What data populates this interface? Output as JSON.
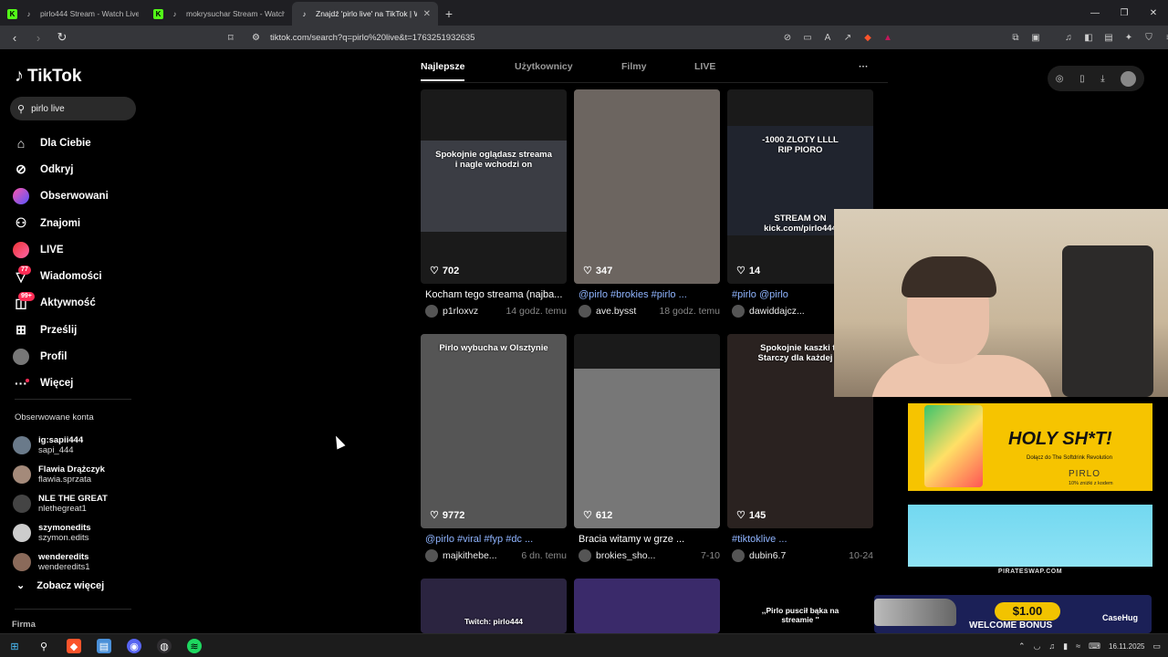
{
  "browser": {
    "tabs": [
      {
        "title": "pirlo444 Stream - Watch Live on",
        "fav_color": "#53fc18",
        "active": false
      },
      {
        "title": "mokrysuchar Stream - Watch Live",
        "fav_color": "#53fc18",
        "active": false
      },
      {
        "title": "Znajdź 'pirlo live' na TikTok | Wy",
        "fav_color": "#000000",
        "active": true
      }
    ],
    "new_tab": "+",
    "url": "tiktok.com/search?q=pirlo%20live&t=1763251932635"
  },
  "sidebar": {
    "logo": "TikTok",
    "search_value": "pirlo live",
    "nav": [
      {
        "label": "Dla Ciebie",
        "icon": "home-icon",
        "glyph": "⌂"
      },
      {
        "label": "Odkryj",
        "icon": "compass-icon",
        "glyph": "⊘"
      },
      {
        "label": "Obserwowani",
        "icon": "following-avatar-icon",
        "glyph": ""
      },
      {
        "label": "Znajomi",
        "icon": "friends-icon",
        "glyph": "⚇"
      },
      {
        "label": "LIVE",
        "icon": "live-avatar-icon",
        "glyph": ""
      },
      {
        "label": "Wiadomości",
        "icon": "messages-icon",
        "glyph": "▽",
        "badge": "77"
      },
      {
        "label": "Aktywność",
        "icon": "activity-icon",
        "glyph": "◫",
        "badge": "99+"
      },
      {
        "label": "Prześlij",
        "icon": "upload-icon",
        "glyph": "⊞"
      },
      {
        "label": "Profil",
        "icon": "profile-avatar-icon",
        "glyph": ""
      },
      {
        "label": "Więcej",
        "icon": "more-icon",
        "glyph": "···"
      }
    ],
    "following_header": "Obserwowane konta",
    "following": [
      {
        "name": "ig:sapii444",
        "handle": "sapi_444"
      },
      {
        "name": "Flawia Drążczyk",
        "handle": "flawia.sprzata"
      },
      {
        "name": "NLE THE GREAT",
        "handle": "nlethegreat1"
      },
      {
        "name": "szymonedits",
        "handle": "szymon.edits"
      },
      {
        "name": "wenderedits",
        "handle": "wenderedits1"
      }
    ],
    "see_more": "Zobacz więcej",
    "company": "Firma"
  },
  "tabs": [
    "Najlepsze",
    "Użytkownicy",
    "Filmy",
    "LIVE"
  ],
  "tabs_more": "···",
  "cards": [
    {
      "likes": "702",
      "desc": "Kocham tego streama (najba...",
      "tag": false,
      "user": "p1rloxvz",
      "time": "14 godz. temu",
      "overlay": "Spokojnie oglądasz streama\ni nagle wchodzi on",
      "bg": "#3b3d44"
    },
    {
      "likes": "347",
      "desc": "@pirlo #brokies #pirlo ...",
      "tag": true,
      "user": "ave.bysst",
      "time": "18 godz. temu",
      "overlay": "",
      "bg": "#6c6560"
    },
    {
      "likes": "14",
      "desc": "#pirlo @pirlo",
      "tag": true,
      "user": "dawiddajcz...",
      "time": "",
      "overlay": "-1000 ZLOTY LLLL\nRIP PIORO",
      "overlay2": "STREAM ON\nkick.com/pirlo444",
      "bg": "#20242e"
    },
    {
      "likes": "9772",
      "desc": "@pirlo #viral #fyp #dc ...",
      "tag": true,
      "user": "majkithebe...",
      "time": "6 dn. temu",
      "overlay": "Pirlo wybucha w Olsztynie",
      "bg": "#555"
    },
    {
      "likes": "612",
      "desc": "Bracia witamy w grze ...",
      "tag": false,
      "user": "brokies_sho...",
      "time": "7-10",
      "overlay": "",
      "bg": "#777"
    },
    {
      "likes": "145",
      "desc": "#tiktoklive ...",
      "tag": true,
      "user": "dubin6.7",
      "time": "10-24",
      "overlay": "Spokojnie kaszki ta\nStarczy dla każdej fa",
      "bg": "#2a2220"
    }
  ],
  "row3": [
    {
      "overlay": "Twitch: pirlo444"
    },
    {
      "overlay": ""
    },
    {
      "overlay": ",,Pirlo puscił bąka na\nstreamie ''"
    }
  ],
  "ads": {
    "holy": "HOLY SH*T!",
    "holy_sub": "Dołącz do The Softdrink Revolution",
    "holy_brand": "PIRLO",
    "holy_code": "10% zniżki z kodem",
    "pirateswap": "PIRATESWAP.COM",
    "price": "$1.00",
    "welcome": "WELCOME BONUS",
    "casehug": "CaseHug"
  },
  "taskbar": {
    "date": "16.11.2025"
  }
}
